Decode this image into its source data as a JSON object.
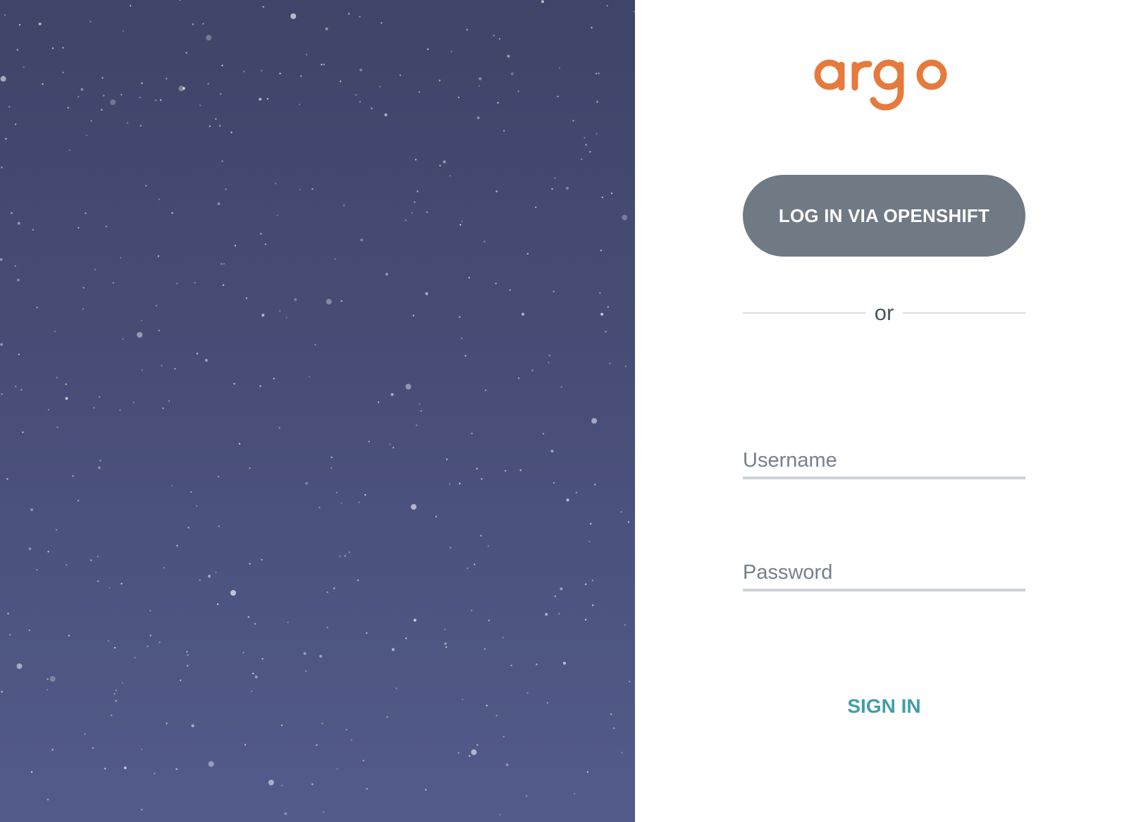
{
  "logo": {
    "text": "argo",
    "color": "#e57a3c"
  },
  "sso_button": {
    "label": "LOG IN VIA OPENSHIFT",
    "background": "#6f7a84"
  },
  "divider": {
    "text": "or"
  },
  "form": {
    "username": {
      "value": "",
      "placeholder": "Username"
    },
    "password": {
      "value": "",
      "placeholder": "Password"
    },
    "submit_label": "SIGN IN",
    "submit_color": "#3f9ea9"
  },
  "background": {
    "description_icon": "starry-sky-background",
    "color_top": "#3f4568",
    "color_bottom": "#535b8b"
  }
}
